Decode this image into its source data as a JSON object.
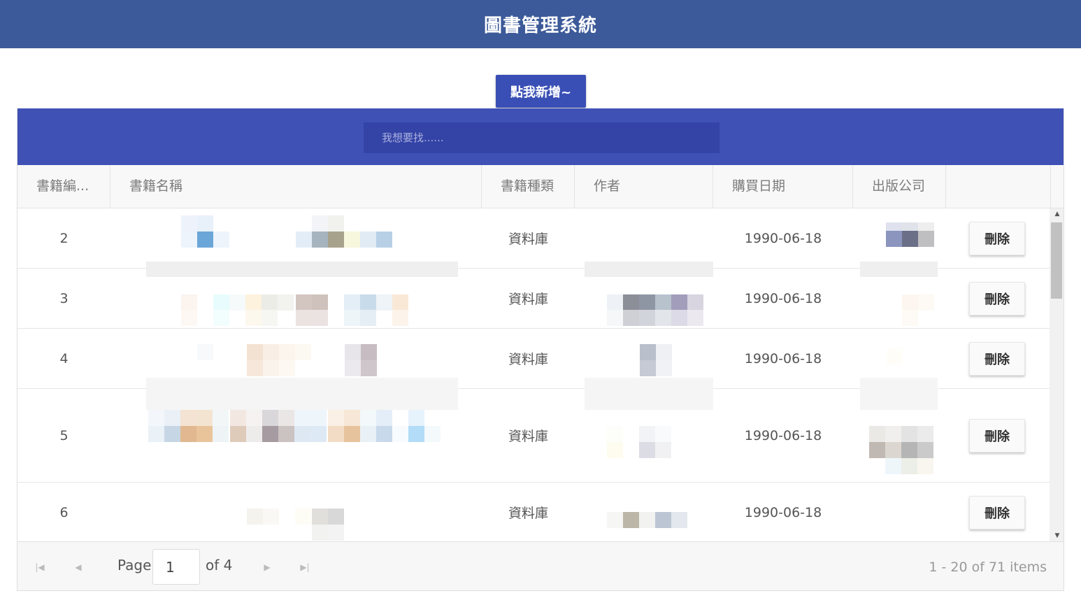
{
  "header": {
    "title": "圖書管理系統"
  },
  "toolbar": {
    "add_label": "點我新增~"
  },
  "search": {
    "placeholder": "我想要找......"
  },
  "table": {
    "columns": [
      "書籍編...",
      "書籍名稱",
      "書籍種類",
      "作者",
      "購買日期",
      "出版公司"
    ],
    "rows": [
      {
        "id": "2",
        "type": "資料庫",
        "date": "1990-06-18",
        "action": "刪除"
      },
      {
        "id": "3",
        "type": "資料庫",
        "date": "1990-06-18",
        "action": "刪除"
      },
      {
        "id": "4",
        "type": "資料庫",
        "date": "1990-06-18",
        "action": "刪除"
      },
      {
        "id": "5",
        "type": "資料庫",
        "date": "1990-06-18",
        "action": "刪除"
      },
      {
        "id": "6",
        "type": "資料庫",
        "date": "1990-06-18",
        "action": "刪除"
      }
    ]
  },
  "pager": {
    "page_label": "Page",
    "current_page": "1",
    "of_label": "of 4",
    "info": "1 - 20 of 71 items"
  },
  "colors": {
    "header_bg": "#3c5a99",
    "toolbar_bg": "#3f51b5",
    "accent": "#3a4fb5"
  }
}
